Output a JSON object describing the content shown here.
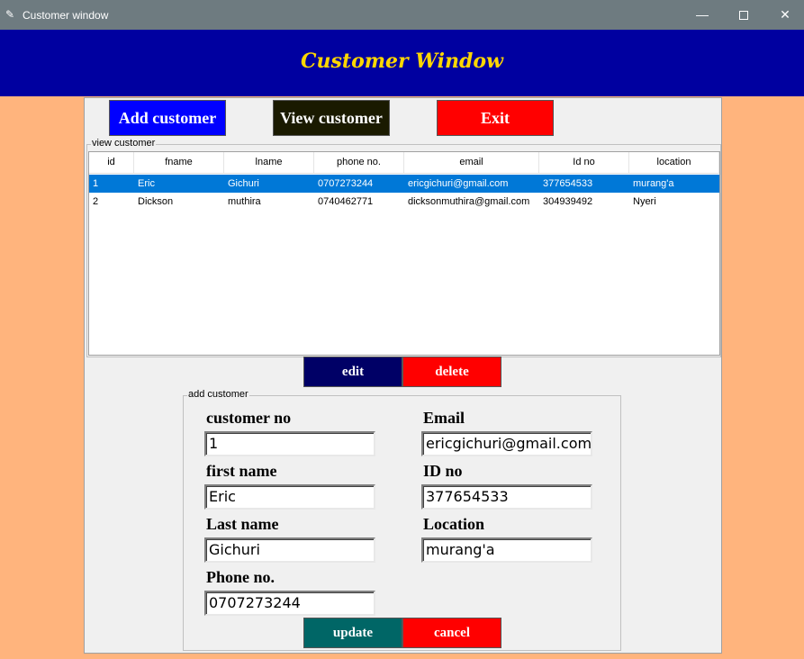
{
  "window": {
    "title": "Customer window",
    "icon": "feather-icon",
    "controls": {
      "minimize": "—",
      "close": "✕"
    }
  },
  "header": {
    "title": "Customer Window"
  },
  "toolbar": {
    "add_label": "Add customer",
    "view_label": "View customer",
    "exit_label": "Exit"
  },
  "view_group": {
    "legend": "view customer",
    "columns": [
      "id",
      "fname",
      "lname",
      "phone no.",
      "email",
      "Id no",
      "location"
    ],
    "rows": [
      {
        "id": "1",
        "fname": "Eric",
        "lname": "Gichuri",
        "phone": "0707273244",
        "email": "ericgichuri@gmail.com",
        "idno": "377654533",
        "location": "murang'a",
        "selected": true
      },
      {
        "id": "2",
        "fname": "Dickson",
        "lname": "muthira",
        "phone": "0740462771",
        "email": "dicksonmuthira@gmail.com",
        "idno": "304939492",
        "location": "Nyeri",
        "selected": false
      }
    ],
    "edit_label": "edit",
    "delete_label": "delete"
  },
  "add_group": {
    "legend": "add customer",
    "fields": {
      "customer_no": {
        "label": "customer no",
        "value": "1"
      },
      "email": {
        "label": "Email",
        "value": "ericgichuri@gmail.com"
      },
      "first_name": {
        "label": "first name",
        "value": "Eric"
      },
      "id_no": {
        "label": "ID no",
        "value": "377654533"
      },
      "last_name": {
        "label": "Last name",
        "value": "Gichuri"
      },
      "location": {
        "label": "Location",
        "value": "murang'a"
      },
      "phone": {
        "label": "Phone no.",
        "value": "0707273244"
      }
    },
    "update_label": "update",
    "cancel_label": "cancel"
  },
  "colors": {
    "background": "#ffb47d",
    "header": "#0000a0",
    "header_text": "#ffd700",
    "selection": "#0078d7"
  }
}
